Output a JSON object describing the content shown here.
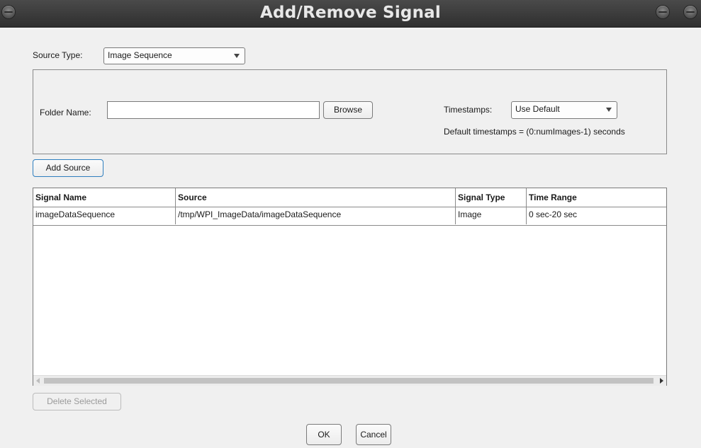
{
  "window": {
    "title": "Add/Remove Signal"
  },
  "source_type": {
    "label": "Source Type:",
    "value": "Image Sequence"
  },
  "panel": {
    "folder_label": "Folder Name:",
    "folder_value": "",
    "browse_label": "Browse",
    "timestamps_label": "Timestamps:",
    "timestamps_value": "Use Default",
    "default_note": "Default timestamps = (0:numImages-1) seconds"
  },
  "add_source_label": "Add Source",
  "table": {
    "columns": [
      "Signal Name",
      "Source",
      "Signal Type",
      "Time Range"
    ],
    "rows": [
      [
        "imageDataSequence",
        "/tmp/WPI_ImageData/imageDataSequence",
        "Image",
        "0 sec-20 sec"
      ]
    ]
  },
  "delete_selected_label": "Delete Selected",
  "ok_label": "OK",
  "cancel_label": "Cancel"
}
